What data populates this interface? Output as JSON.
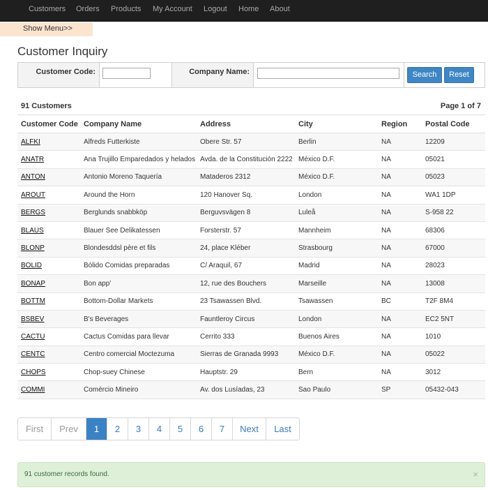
{
  "nav": {
    "items": [
      {
        "label": "Customers"
      },
      {
        "label": "Orders"
      },
      {
        "label": "Products"
      },
      {
        "label": "My Account"
      },
      {
        "label": "Logout"
      },
      {
        "label": "Home"
      },
      {
        "label": "About"
      }
    ]
  },
  "show_menu_label": "Show Menu>>",
  "page_title": "Customer Inquiry",
  "search": {
    "customer_code_label": "Customer Code:",
    "customer_code_value": "",
    "company_name_label": "Company Name:",
    "company_name_value": "",
    "search_button": "Search",
    "reset_button": "Reset"
  },
  "summary": {
    "count_label": "91 Customers",
    "page_label": "Page",
    "current_page": "1",
    "of_label": "of",
    "total_pages": "7"
  },
  "table": {
    "columns": [
      "Customer Code",
      "Company Name",
      "Address",
      "City",
      "Region",
      "Postal Code"
    ],
    "rows": [
      [
        "ALFKI",
        "Alfreds Futterkiste",
        "Obere Str. 57",
        "Berlin",
        "NA",
        "12209"
      ],
      [
        "ANATR",
        "Ana Trujillo Emparedados y helados",
        "Avda. de la Constitución 2222",
        "México D.F.",
        "NA",
        "05021"
      ],
      [
        "ANTON",
        "Antonio Moreno Taquería",
        "Mataderos 2312",
        "México D.F.",
        "NA",
        "05023"
      ],
      [
        "AROUT",
        "Around the Horn",
        "120 Hanover Sq.",
        "London",
        "NA",
        "WA1 1DP"
      ],
      [
        "BERGS",
        "Berglunds snabbköp",
        "Berguvsvägen 8",
        "Luleå",
        "NA",
        "S-958 22"
      ],
      [
        "BLAUS",
        "Blauer See Delikatessen",
        "Forsterstr. 57",
        "Mannheim",
        "NA",
        "68306"
      ],
      [
        "BLONP",
        "Blondesddsl père et fils",
        "24, place Kléber",
        "Strasbourg",
        "NA",
        "67000"
      ],
      [
        "BOLID",
        "Bólido Comidas preparadas",
        "C/ Araquil, 67",
        "Madrid",
        "NA",
        "28023"
      ],
      [
        "BONAP",
        "Bon app'",
        "12, rue des Bouchers",
        "Marseille",
        "NA",
        "13008"
      ],
      [
        "BOTTM",
        "Bottom-Dollar Markets",
        "23 Tsawassen Blvd.",
        "Tsawassen",
        "BC",
        "T2F 8M4"
      ],
      [
        "BSBEV",
        "B's Beverages",
        "Fauntleroy Circus",
        "London",
        "NA",
        "EC2 5NT"
      ],
      [
        "CACTU",
        "Cactus Comidas para llevar",
        "Cerrito 333",
        "Buenos Aires",
        "NA",
        "1010"
      ],
      [
        "CENTC",
        "Centro comercial Moctezuma",
        "Sierras de Granada 9993",
        "México D.F.",
        "NA",
        "05022"
      ],
      [
        "CHOPS",
        "Chop-suey Chinese",
        "Hauptstr. 29",
        "Bern",
        "NA",
        "3012"
      ],
      [
        "COMMI",
        "Comércio Mineiro",
        "Av. dos Lusíadas, 23",
        "Sao Paulo",
        "SP",
        "05432-043"
      ]
    ]
  },
  "pager": {
    "first": "First",
    "prev": "Prev",
    "pages": [
      "1",
      "2",
      "3",
      "4",
      "5",
      "6",
      "7"
    ],
    "active_page": "1",
    "next": "Next",
    "last": "Last"
  },
  "alert": {
    "message": "91 customer records found.",
    "close": "×"
  }
}
